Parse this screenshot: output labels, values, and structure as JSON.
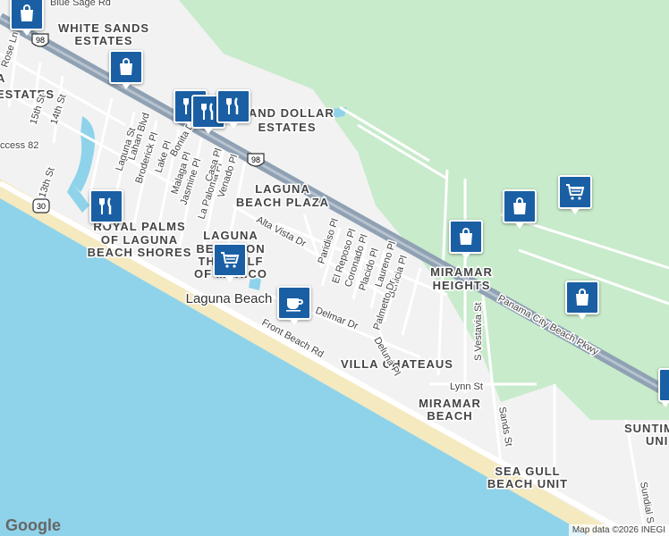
{
  "areas": {
    "white_sands_1": "WHITE SANDS",
    "white_sands_2": "ESTATES",
    "sand_dollar_1": "SAND DOLLAR",
    "sand_dollar_2": "ESTATES",
    "laguna_plaza_1": "LAGUNA",
    "laguna_plaza_2": "BEACH PLAZA",
    "royal_palms_1": "ROYAL PALMS",
    "royal_palms_2": "OF LAGUNA",
    "royal_palms_3": "BEACH SHORES",
    "laguna_gulf_1": "LAGUNA",
    "laguna_gulf_2": "BEACH ON",
    "laguna_gulf_3": "THE GULF",
    "laguna_gulf_4": "OF MEXICO",
    "miramar_heights_1": "MIRAMAR",
    "miramar_heights_2": "HEIGHTS",
    "villa_chateaus": "VILLA CHATEAUS",
    "miramar_beach_1": "MIRAMAR",
    "miramar_beach_2": "BEACH",
    "sea_gull_1": "SEA GULL",
    "sea_gull_2": "BEACH UNIT",
    "suntime_1": "SUNTIM",
    "suntime_2": "UNI",
    "estates_partial": "ESTATES",
    "a_partial": "A",
    "laguna_beach_town": "Laguna Beach"
  },
  "roads": {
    "blue_sage": "Blue Sage Rd",
    "rose_ln": "Rose Ln",
    "st_15": "15th St",
    "st_14": "14th St",
    "st_13": "13th St",
    "access82": "ccess 82",
    "laguna_st": "Laguna St",
    "lahan_blvd": "Lahan Blvd",
    "broderick_pl": "Broderick Pl",
    "lake_pl": "Lake Pl",
    "bonita_dr": "Bonita Dr",
    "malaga_pl": "Malaga Pl",
    "jasmine_pl": "Jasmine Pl",
    "la_paloma_pl": "La Paloma Pl",
    "casa_pl": "Casa Pl",
    "venado_pl": "Venado Pl",
    "alta_vista": "Alta Vista Dr",
    "paridiso_pl": "Paridiso Pl",
    "el_reposo": "El Reposo Pl",
    "coronado_pl": "Coronado Pl",
    "placido_pl": "Placido Pl",
    "laureno_pl": "Laureno Pl",
    "benicia_pl": "Benicia Pl",
    "palmetto_dr": "Palmetto Dr",
    "deluna_pl": "Deluna Pl",
    "delmar_dr": "Delmar Dr",
    "front_beach": "Front Beach Rd",
    "pcb_pkwy": "Panama City Beach Pkwy",
    "s_vestavia": "S Vestavia St",
    "lynn_st": "Lynn St",
    "sands_st": "Sands St",
    "sundial": "Sundial S"
  },
  "shields": {
    "us98_a": "98",
    "us98_b": "98",
    "sr30": "30"
  },
  "pois": [
    {
      "icon": "shopping-bag-icon"
    },
    {
      "icon": "shopping-bag-icon"
    },
    {
      "icon": "restaurant-icon"
    },
    {
      "icon": "restaurant-icon"
    },
    {
      "icon": "restaurant-icon"
    },
    {
      "icon": "restaurant-icon"
    },
    {
      "icon": "grocery-cart-icon"
    },
    {
      "icon": "coffee-cup-icon"
    },
    {
      "icon": "shopping-bag-icon"
    },
    {
      "icon": "shopping-bag-icon"
    },
    {
      "icon": "grocery-cart-icon"
    },
    {
      "icon": "shopping-bag-icon"
    }
  ],
  "colors": {
    "water": "#8fd3ea",
    "park": "#c8ebcb",
    "highway": "#8fa1b3",
    "poi": "#1a5fa4",
    "sand": "#f5e9c0"
  },
  "logo": "Google",
  "attribution": "Map data ©2026 INEGI"
}
